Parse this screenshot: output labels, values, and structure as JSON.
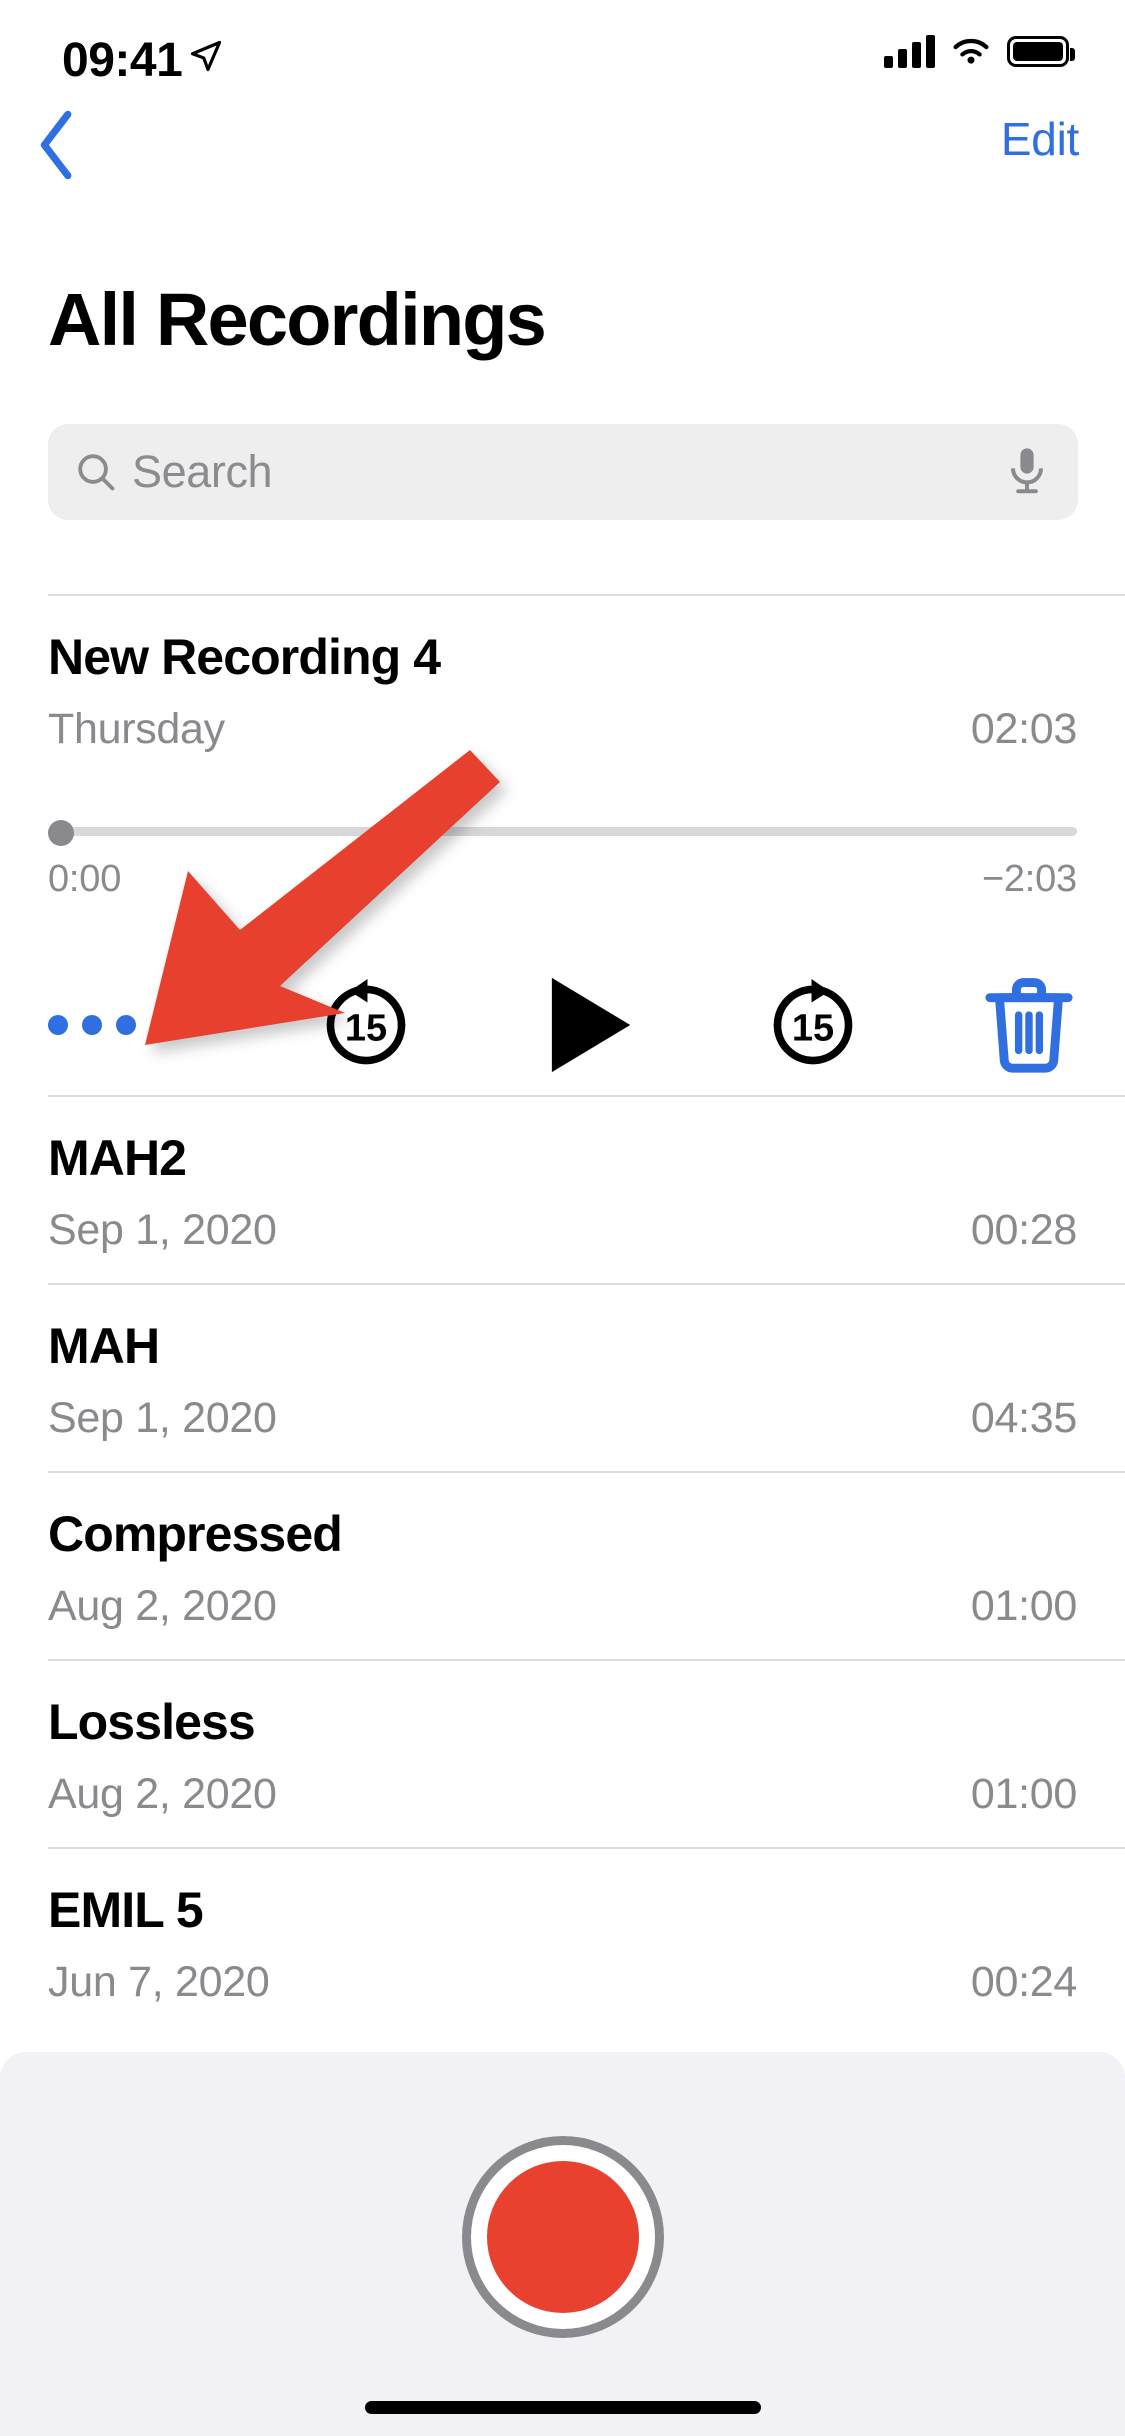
{
  "status_bar": {
    "time": "09:41",
    "location_icon": "location-arrow-icon",
    "cellular_icon": "cellular-bars-icon",
    "wifi_icon": "wifi-icon",
    "battery_icon": "battery-full-icon"
  },
  "nav": {
    "back_icon": "chevron-left-icon",
    "edit_label": "Edit"
  },
  "header": {
    "title": "All Recordings"
  },
  "search": {
    "placeholder": "Search",
    "value": "",
    "search_icon": "search-icon",
    "mic_icon": "microphone-icon"
  },
  "selected_recording": {
    "title": "New Recording 4",
    "date": "Thursday",
    "duration": "02:03",
    "elapsed_time": "0:00",
    "remaining_time": "−2:03",
    "progress_percent": 0,
    "controls": {
      "more_label": "•••",
      "more_icon": "ellipsis-icon",
      "skip_back_icon": "skip-back-15-icon",
      "skip_back_value": "15",
      "play_icon": "play-icon",
      "skip_forward_icon": "skip-forward-15-icon",
      "skip_forward_value": "15",
      "delete_icon": "trash-icon"
    }
  },
  "recordings": [
    {
      "title": "MAH2",
      "date": "Sep 1, 2020",
      "duration": "00:28"
    },
    {
      "title": "MAH",
      "date": "Sep 1, 2020",
      "duration": "04:35"
    },
    {
      "title": "Compressed",
      "date": "Aug 2, 2020",
      "duration": "01:00"
    },
    {
      "title": "Lossless",
      "date": "Aug 2, 2020",
      "duration": "01:00"
    },
    {
      "title": "EMIL 5",
      "date": "Jun 7, 2020",
      "duration": "00:24"
    }
  ],
  "record_bar": {
    "record_icon": "record-button-icon",
    "home_indicator": "home-indicator"
  },
  "annotation": {
    "arrow_icon": "red-arrow-annotation",
    "color": "#e8412f",
    "points_to": "more-options-button"
  },
  "colors": {
    "accent_blue": "#2f6fe0",
    "record_red": "#e8412f",
    "secondary_text": "#8a8a8e",
    "separator": "#dcdcdd",
    "search_background": "#eeeeef",
    "panel_background": "#f2f1f6"
  }
}
